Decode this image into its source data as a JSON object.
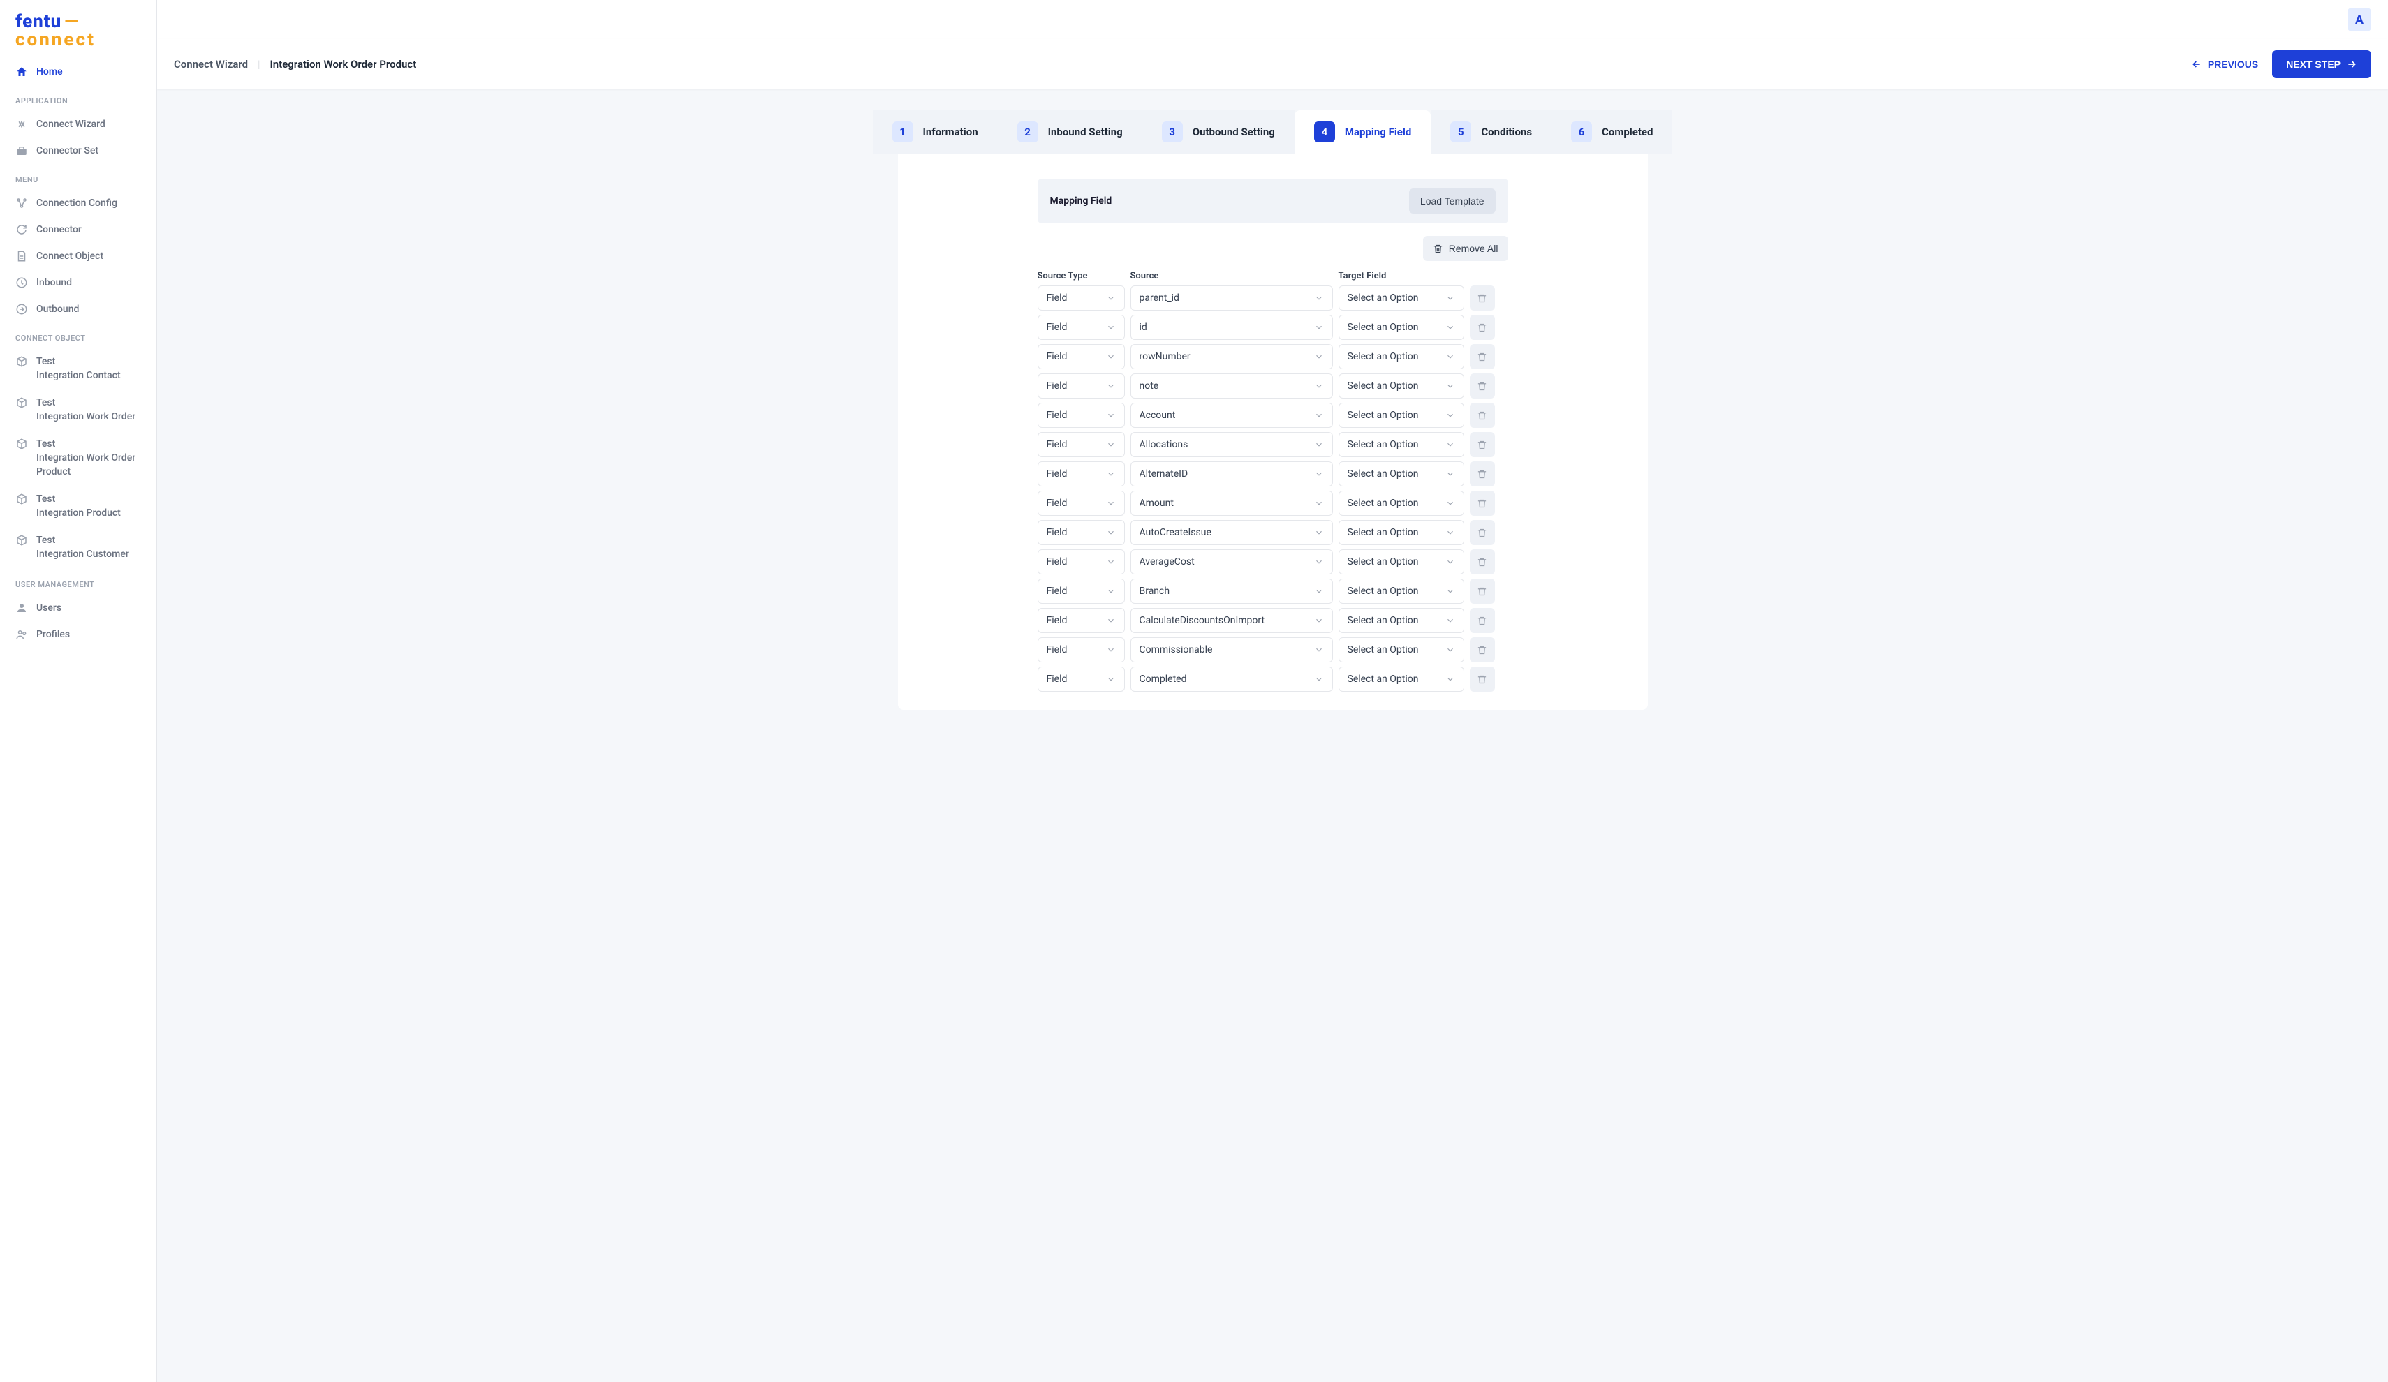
{
  "logo": {
    "top": "fentu",
    "dash": "—",
    "bottom": "connect"
  },
  "avatar": "A",
  "sidebar": {
    "home": "Home",
    "sections": [
      {
        "title": "APPLICATION",
        "items": [
          {
            "label": "Connect Wizard",
            "icon": "wizard"
          },
          {
            "label": "Connector Set",
            "icon": "briefcase"
          }
        ]
      },
      {
        "title": "MENU",
        "items": [
          {
            "label": "Connection Config",
            "icon": "nodes"
          },
          {
            "label": "Connector",
            "icon": "refresh"
          },
          {
            "label": "Connect Object",
            "icon": "document"
          },
          {
            "label": "Inbound",
            "icon": "inbound"
          },
          {
            "label": "Outbound",
            "icon": "outbound"
          }
        ]
      },
      {
        "title": "CONNECT OBJECT",
        "items": [
          {
            "label1": "Test",
            "label2": "Integration Contact",
            "icon": "cube"
          },
          {
            "label1": "Test",
            "label2": "Integration Work Order",
            "icon": "cube"
          },
          {
            "label1": "Test",
            "label2": "Integration Work Order Product",
            "icon": "cube"
          },
          {
            "label1": "Test",
            "label2": "Integration Product",
            "icon": "cube"
          },
          {
            "label1": "Test",
            "label2": "Integration Customer",
            "icon": "cube"
          }
        ]
      },
      {
        "title": "USER MANAGEMENT",
        "items": [
          {
            "label": "Users",
            "icon": "user"
          },
          {
            "label": "Profiles",
            "icon": "profiles"
          }
        ]
      }
    ]
  },
  "breadcrumb": {
    "part1": "Connect Wizard",
    "part2": "Integration Work Order Product"
  },
  "navButtons": {
    "previous": "PREVIOUS",
    "next": "NEXT STEP"
  },
  "steps": [
    {
      "num": "1",
      "label": "Information"
    },
    {
      "num": "2",
      "label": "Inbound Setting"
    },
    {
      "num": "3",
      "label": "Outbound Setting"
    },
    {
      "num": "4",
      "label": "Mapping Field"
    },
    {
      "num": "5",
      "label": "Conditions"
    },
    {
      "num": "6",
      "label": "Completed"
    }
  ],
  "activeStep": 3,
  "panel": {
    "title": "Mapping Field",
    "loadTemplate": "Load Template",
    "removeAll": "Remove All",
    "columns": {
      "sourceType": "Source Type",
      "source": "Source",
      "targetField": "Target Field"
    },
    "defaults": {
      "sourceType": "Field",
      "targetField": "Select an Option"
    },
    "rows": [
      {
        "source": "parent_id"
      },
      {
        "source": "id"
      },
      {
        "source": "rowNumber"
      },
      {
        "source": "note"
      },
      {
        "source": "Account"
      },
      {
        "source": "Allocations"
      },
      {
        "source": "AlternateID"
      },
      {
        "source": "Amount"
      },
      {
        "source": "AutoCreateIssue"
      },
      {
        "source": "AverageCost"
      },
      {
        "source": "Branch"
      },
      {
        "source": "CalculateDiscountsOnImport"
      },
      {
        "source": "Commissionable"
      },
      {
        "source": "Completed"
      }
    ]
  }
}
